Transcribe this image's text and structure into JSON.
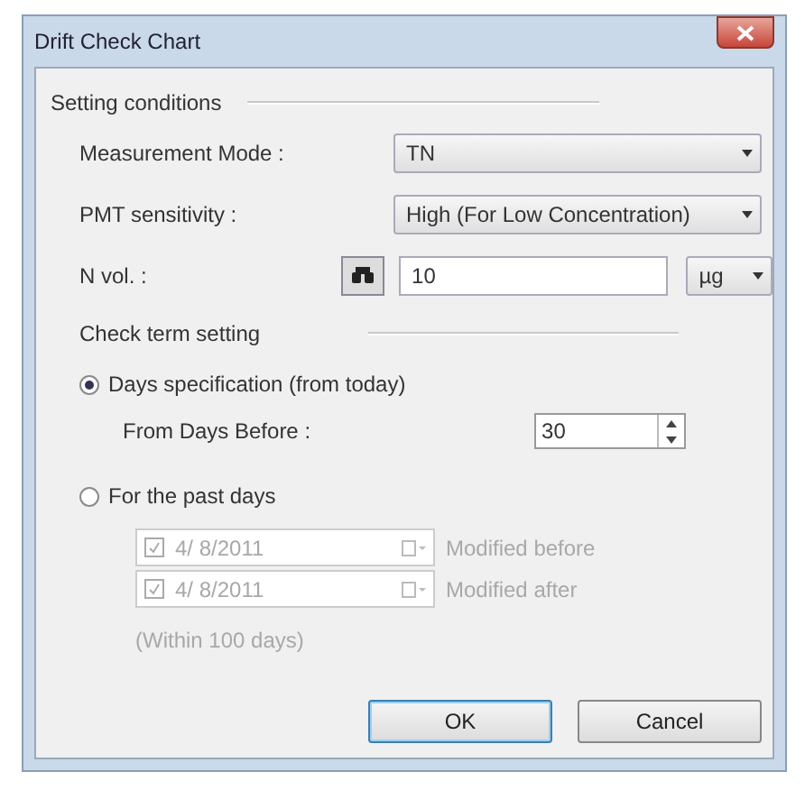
{
  "window": {
    "title": "Drift Check Chart"
  },
  "setting_conditions": {
    "heading": "Setting conditions",
    "fields": [
      {
        "label": "Measurement Mode :",
        "kind": "combo",
        "value": "TN"
      },
      {
        "label": "PMT sensitivity :",
        "kind": "combo",
        "value": "High (For Low Concentration)"
      },
      {
        "label": "N vol. :",
        "kind": "volume",
        "value": "10",
        "unit": "µg"
      }
    ]
  },
  "check_term": {
    "heading": "Check term setting",
    "options": [
      {
        "kind": "days",
        "label": "Days specification (from today)",
        "selected": true,
        "from_days_label": "From Days Before :",
        "from_days_value": "30"
      },
      {
        "kind": "past",
        "label": "For the past days",
        "selected": false,
        "dates": [
          {
            "date": "4/ 8/2011",
            "checked": true,
            "disabled": true,
            "label": "Modified before"
          },
          {
            "date": "4/ 8/2011",
            "checked": true,
            "disabled": true,
            "label": "Modified after"
          }
        ],
        "note": "(Within 100 days)"
      }
    ]
  },
  "buttons": [
    {
      "label": "OK",
      "default": true
    },
    {
      "label": "Cancel",
      "default": false
    }
  ]
}
